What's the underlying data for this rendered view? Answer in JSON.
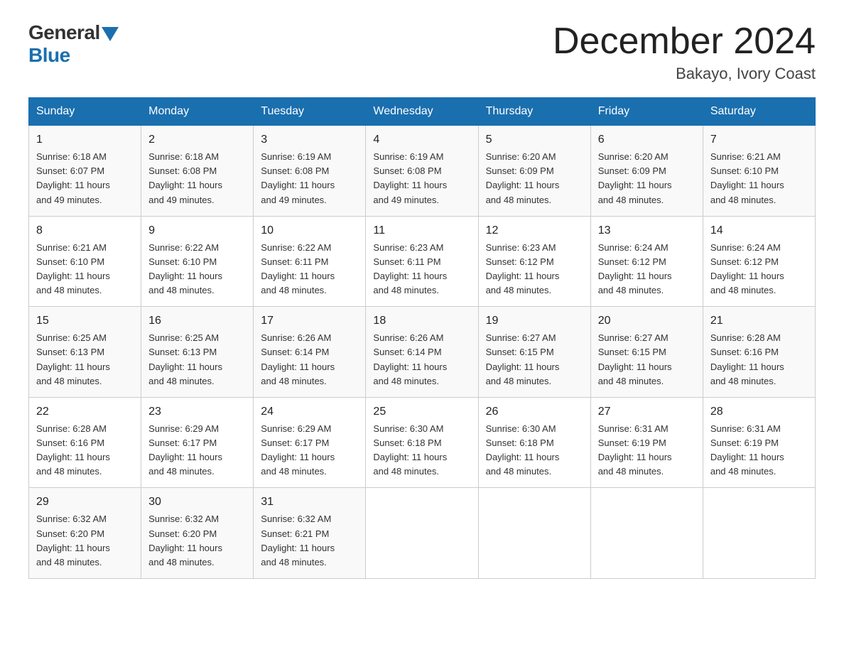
{
  "logo": {
    "general": "General",
    "blue": "Blue"
  },
  "title": "December 2024",
  "location": "Bakayo, Ivory Coast",
  "headers": [
    "Sunday",
    "Monday",
    "Tuesday",
    "Wednesday",
    "Thursday",
    "Friday",
    "Saturday"
  ],
  "weeks": [
    [
      {
        "day": "1",
        "sunrise": "6:18 AM",
        "sunset": "6:07 PM",
        "daylight": "11 hours and 49 minutes."
      },
      {
        "day": "2",
        "sunrise": "6:18 AM",
        "sunset": "6:08 PM",
        "daylight": "11 hours and 49 minutes."
      },
      {
        "day": "3",
        "sunrise": "6:19 AM",
        "sunset": "6:08 PM",
        "daylight": "11 hours and 49 minutes."
      },
      {
        "day": "4",
        "sunrise": "6:19 AM",
        "sunset": "6:08 PM",
        "daylight": "11 hours and 49 minutes."
      },
      {
        "day": "5",
        "sunrise": "6:20 AM",
        "sunset": "6:09 PM",
        "daylight": "11 hours and 48 minutes."
      },
      {
        "day": "6",
        "sunrise": "6:20 AM",
        "sunset": "6:09 PM",
        "daylight": "11 hours and 48 minutes."
      },
      {
        "day": "7",
        "sunrise": "6:21 AM",
        "sunset": "6:10 PM",
        "daylight": "11 hours and 48 minutes."
      }
    ],
    [
      {
        "day": "8",
        "sunrise": "6:21 AM",
        "sunset": "6:10 PM",
        "daylight": "11 hours and 48 minutes."
      },
      {
        "day": "9",
        "sunrise": "6:22 AM",
        "sunset": "6:10 PM",
        "daylight": "11 hours and 48 minutes."
      },
      {
        "day": "10",
        "sunrise": "6:22 AM",
        "sunset": "6:11 PM",
        "daylight": "11 hours and 48 minutes."
      },
      {
        "day": "11",
        "sunrise": "6:23 AM",
        "sunset": "6:11 PM",
        "daylight": "11 hours and 48 minutes."
      },
      {
        "day": "12",
        "sunrise": "6:23 AM",
        "sunset": "6:12 PM",
        "daylight": "11 hours and 48 minutes."
      },
      {
        "day": "13",
        "sunrise": "6:24 AM",
        "sunset": "6:12 PM",
        "daylight": "11 hours and 48 minutes."
      },
      {
        "day": "14",
        "sunrise": "6:24 AM",
        "sunset": "6:12 PM",
        "daylight": "11 hours and 48 minutes."
      }
    ],
    [
      {
        "day": "15",
        "sunrise": "6:25 AM",
        "sunset": "6:13 PM",
        "daylight": "11 hours and 48 minutes."
      },
      {
        "day": "16",
        "sunrise": "6:25 AM",
        "sunset": "6:13 PM",
        "daylight": "11 hours and 48 minutes."
      },
      {
        "day": "17",
        "sunrise": "6:26 AM",
        "sunset": "6:14 PM",
        "daylight": "11 hours and 48 minutes."
      },
      {
        "day": "18",
        "sunrise": "6:26 AM",
        "sunset": "6:14 PM",
        "daylight": "11 hours and 48 minutes."
      },
      {
        "day": "19",
        "sunrise": "6:27 AM",
        "sunset": "6:15 PM",
        "daylight": "11 hours and 48 minutes."
      },
      {
        "day": "20",
        "sunrise": "6:27 AM",
        "sunset": "6:15 PM",
        "daylight": "11 hours and 48 minutes."
      },
      {
        "day": "21",
        "sunrise": "6:28 AM",
        "sunset": "6:16 PM",
        "daylight": "11 hours and 48 minutes."
      }
    ],
    [
      {
        "day": "22",
        "sunrise": "6:28 AM",
        "sunset": "6:16 PM",
        "daylight": "11 hours and 48 minutes."
      },
      {
        "day": "23",
        "sunrise": "6:29 AM",
        "sunset": "6:17 PM",
        "daylight": "11 hours and 48 minutes."
      },
      {
        "day": "24",
        "sunrise": "6:29 AM",
        "sunset": "6:17 PM",
        "daylight": "11 hours and 48 minutes."
      },
      {
        "day": "25",
        "sunrise": "6:30 AM",
        "sunset": "6:18 PM",
        "daylight": "11 hours and 48 minutes."
      },
      {
        "day": "26",
        "sunrise": "6:30 AM",
        "sunset": "6:18 PM",
        "daylight": "11 hours and 48 minutes."
      },
      {
        "day": "27",
        "sunrise": "6:31 AM",
        "sunset": "6:19 PM",
        "daylight": "11 hours and 48 minutes."
      },
      {
        "day": "28",
        "sunrise": "6:31 AM",
        "sunset": "6:19 PM",
        "daylight": "11 hours and 48 minutes."
      }
    ],
    [
      {
        "day": "29",
        "sunrise": "6:32 AM",
        "sunset": "6:20 PM",
        "daylight": "11 hours and 48 minutes."
      },
      {
        "day": "30",
        "sunrise": "6:32 AM",
        "sunset": "6:20 PM",
        "daylight": "11 hours and 48 minutes."
      },
      {
        "day": "31",
        "sunrise": "6:32 AM",
        "sunset": "6:21 PM",
        "daylight": "11 hours and 48 minutes."
      },
      null,
      null,
      null,
      null
    ]
  ],
  "labels": {
    "sunrise": "Sunrise:",
    "sunset": "Sunset:",
    "daylight": "Daylight:"
  }
}
